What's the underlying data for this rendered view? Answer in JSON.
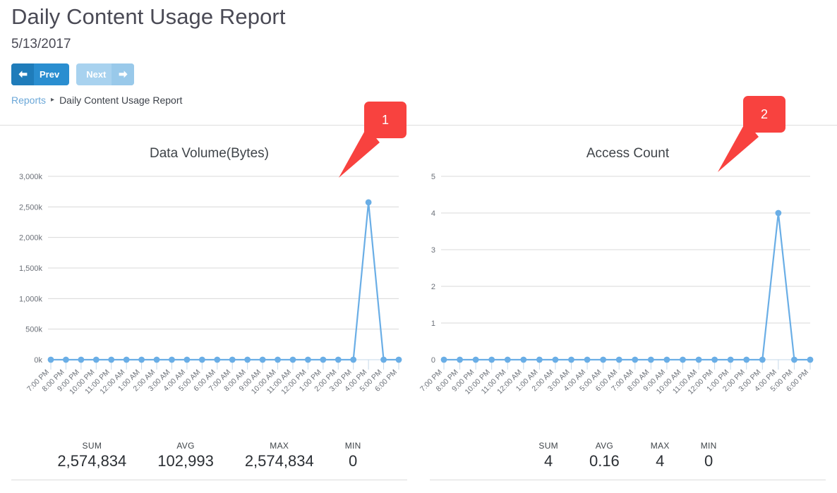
{
  "header": {
    "title": "Daily Content Usage Report",
    "date": "5/13/2017"
  },
  "nav": {
    "prev_label": "Prev",
    "next_label": "Next",
    "prev_icon": "arrow-left-icon",
    "next_icon": "arrow-right-icon",
    "prev_color": "#2a8ed0",
    "next_color": "#a8d2ef"
  },
  "breadcrumb": {
    "root": "Reports",
    "separator": "▸",
    "current": "Daily Content Usage Report"
  },
  "callouts": [
    {
      "label": "1",
      "color": "#f8423f"
    },
    {
      "label": "2",
      "color": "#f8423f"
    }
  ],
  "stats_labels": {
    "sum": "SUM",
    "avg": "AVG",
    "max": "MAX",
    "min": "MIN"
  },
  "panels": [
    {
      "title": "Data Volume(Bytes)",
      "stats": [
        {
          "label": "SUM",
          "value": "2,574,834"
        },
        {
          "label": "AVG",
          "value": "102,993"
        },
        {
          "label": "MAX",
          "value": "2,574,834"
        },
        {
          "label": "MIN",
          "value": "0"
        }
      ]
    },
    {
      "title": "Access Count",
      "stats": [
        {
          "label": "SUM",
          "value": "4"
        },
        {
          "label": "AVG",
          "value": "0.16"
        },
        {
          "label": "MAX",
          "value": "4"
        },
        {
          "label": "MIN",
          "value": "0"
        }
      ]
    }
  ],
  "chart_data": [
    {
      "type": "line",
      "title": "Data Volume(Bytes)",
      "xlabel": "",
      "ylabel": "",
      "grid": true,
      "legend": false,
      "line_color": "#6aaee6",
      "marker_color": "#6aaee6",
      "ylim": [
        0,
        3000000
      ],
      "ytick_labels": [
        "0k",
        "500k",
        "1,000k",
        "1,500k",
        "2,000k",
        "2,500k",
        "3,000k"
      ],
      "ytick_values": [
        0,
        500000,
        1000000,
        1500000,
        2000000,
        2500000,
        3000000
      ],
      "categories": [
        "7:00 PM",
        "8:00 PM",
        "9:00 PM",
        "10:00 PM",
        "11:00 PM",
        "12:00 AM",
        "1:00 AM",
        "2:00 AM",
        "3:00 AM",
        "4:00 AM",
        "5:00 AM",
        "6:00 AM",
        "7:00 AM",
        "8:00 AM",
        "9:00 AM",
        "10:00 AM",
        "11:00 AM",
        "12:00 PM",
        "1:00 PM",
        "2:00 PM",
        "3:00 PM",
        "4:00 PM",
        "5:00 PM",
        "6:00 PM"
      ],
      "values": [
        0,
        0,
        0,
        0,
        0,
        0,
        0,
        0,
        0,
        0,
        0,
        0,
        0,
        0,
        0,
        0,
        0,
        0,
        0,
        0,
        0,
        2574834,
        0,
        0
      ]
    },
    {
      "type": "line",
      "title": "Access Count",
      "xlabel": "",
      "ylabel": "",
      "grid": true,
      "legend": false,
      "line_color": "#6aaee6",
      "marker_color": "#6aaee6",
      "ylim": [
        0,
        5
      ],
      "ytick_labels": [
        "0",
        "1",
        "2",
        "3",
        "4",
        "5"
      ],
      "ytick_values": [
        0,
        1,
        2,
        3,
        4,
        5
      ],
      "categories": [
        "7:00 PM",
        "8:00 PM",
        "9:00 PM",
        "10:00 PM",
        "11:00 PM",
        "12:00 AM",
        "1:00 AM",
        "2:00 AM",
        "3:00 AM",
        "4:00 AM",
        "5:00 AM",
        "6:00 AM",
        "7:00 AM",
        "8:00 AM",
        "9:00 AM",
        "10:00 AM",
        "11:00 AM",
        "12:00 PM",
        "1:00 PM",
        "2:00 PM",
        "3:00 PM",
        "4:00 PM",
        "5:00 PM",
        "6:00 PM"
      ],
      "values": [
        0,
        0,
        0,
        0,
        0,
        0,
        0,
        0,
        0,
        0,
        0,
        0,
        0,
        0,
        0,
        0,
        0,
        0,
        0,
        0,
        0,
        4,
        0,
        0
      ]
    }
  ]
}
